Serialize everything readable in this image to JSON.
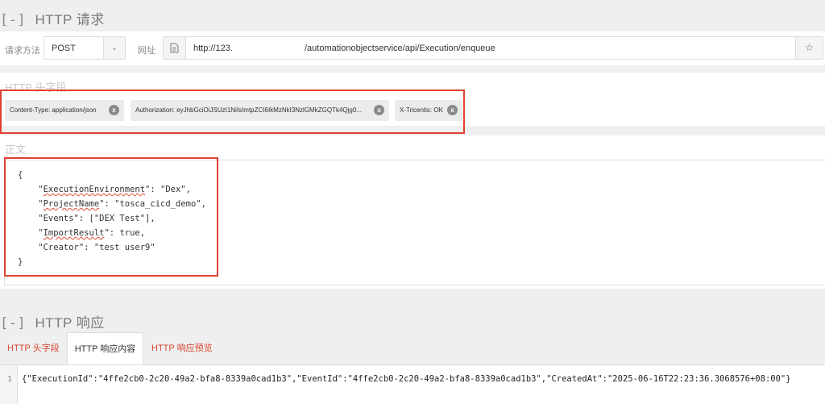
{
  "request_section": {
    "bracket": "[-]",
    "title": "HTTP 请求"
  },
  "request": {
    "method_label": "请求方法",
    "method_value": "POST",
    "url_label": "网址",
    "url_part1": "http://123.",
    "url_part2": "/automationobjectservice/api/Execution/enqueue"
  },
  "headers_panel": {
    "label": "HTTP 头字段",
    "tags": [
      {
        "text": "Content-Type: application/json"
      },
      {
        "text": "Authorization: eyJhbGciOiJSUzI1NiIsImtpZCI6IkMzNkI3NzlGMkZGQTk4Qjg0..."
      },
      {
        "text": "X-Tricentis: OK"
      }
    ]
  },
  "body_panel": {
    "label": "正文",
    "lines": {
      "open": "{",
      "l1_key": "ExecutionEnvironment",
      "l1_val": ": \"Dex\",",
      "l2_key": "ProjectName",
      "l2_val": ": \"tosca_cicd_demo\",",
      "l3": "    \"Events\": [\"DEX Test\"],",
      "l4_key": "ImportResult",
      "l4_val": ": true,",
      "l5": "    \"Creator\": \"test user9\"",
      "close": "}"
    }
  },
  "response_section": {
    "bracket": "[-]",
    "title": "HTTP 响应"
  },
  "response_tabs": [
    "HTTP 头字段",
    "HTTP 响应内容",
    "HTTP 响应预览"
  ],
  "response": {
    "line_number": "1",
    "content": "{\"ExecutionId\":\"4ffe2cb0-2c20-49a2-bfa8-8339a0cad1b3\",\"EventId\":\"4ffe2cb0-2c20-49a2-bfa8-8339a0cad1b3\",\"CreatedAt\":\"2025-06-16T22:23:36.3068576+08:00\"}"
  },
  "colors": {
    "accent_red": "#e0412f",
    "tab_red": "#d9442f"
  }
}
